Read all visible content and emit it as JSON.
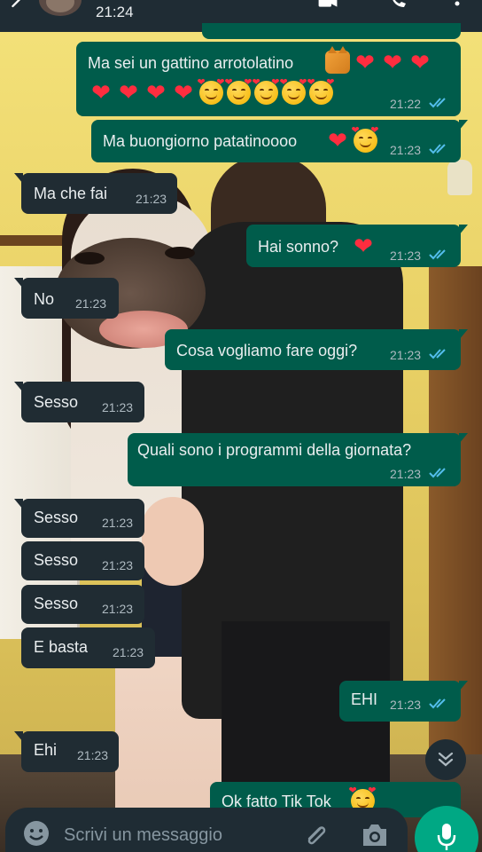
{
  "colors": {
    "header_bg": "#1f2c34",
    "outgoing_bubble": "#005c4b",
    "incoming_bubble": "#202c33",
    "read_ticks": "#53bdeb",
    "mic_button": "#00a884"
  },
  "header": {
    "subtitle": "21:24",
    "icons": [
      "back-arrow-icon",
      "video-call-icon",
      "phone-call-icon",
      "more-menu-icon"
    ]
  },
  "messages": [
    {
      "dir": "out",
      "text": "Ma sei un gattino arrotolatino",
      "emoji": [
        "cat-face",
        "red-heart",
        "red-heart",
        "red-heart",
        "red-heart",
        "red-heart",
        "red-heart",
        "red-heart",
        "smiling-face-with-hearts",
        "smiling-face-with-hearts",
        "smiling-face-with-hearts",
        "smiling-face-with-hearts",
        "smiling-face-with-hearts"
      ],
      "time": "21:22",
      "status": "read"
    },
    {
      "dir": "out",
      "text": "Ma buongiorno patatinoooo",
      "emoji": [
        "red-heart",
        "smiling-face-with-hearts"
      ],
      "time": "21:23",
      "status": "read"
    },
    {
      "dir": "in",
      "text": "Ma che fai",
      "time": "21:23"
    },
    {
      "dir": "out",
      "text": "Hai sonno?",
      "emoji": [
        "red-heart"
      ],
      "time": "21:23",
      "status": "read"
    },
    {
      "dir": "in",
      "text": "No",
      "time": "21:23"
    },
    {
      "dir": "out",
      "text": "Cosa vogliamo fare oggi?",
      "time": "21:23",
      "status": "read"
    },
    {
      "dir": "in",
      "text": "Sesso",
      "time": "21:23"
    },
    {
      "dir": "out",
      "text": "Quali sono i programmi della giornata?",
      "time": "21:23",
      "status": "read"
    },
    {
      "dir": "in",
      "text": "Sesso",
      "time": "21:23"
    },
    {
      "dir": "in",
      "text": "Sesso",
      "time": "21:23"
    },
    {
      "dir": "in",
      "text": "Sesso",
      "time": "21:23"
    },
    {
      "dir": "in",
      "text": "E basta",
      "time": "21:23"
    },
    {
      "dir": "out",
      "text": "EHI",
      "time": "21:23",
      "status": "read"
    },
    {
      "dir": "in",
      "text": "Ehi",
      "time": "21:23"
    },
    {
      "dir": "out",
      "text": "Ok fatto Tik Tok",
      "emoji": [
        "smiling-face-with-hearts"
      ],
      "partial": true
    }
  ],
  "composer": {
    "placeholder": "Scrivi un messaggio",
    "icons": [
      "emoji-icon",
      "attach-icon",
      "camera-icon",
      "mic-icon"
    ]
  },
  "scroll_button": {
    "icon": "double-chevron-down-icon"
  }
}
